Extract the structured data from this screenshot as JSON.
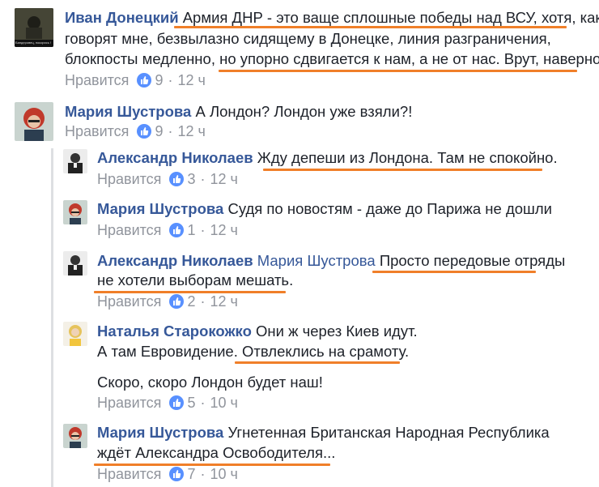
{
  "like_label": "Нравится",
  "accent": "#f07f29",
  "comments": [
    {
      "author": "Иван Донецкий",
      "lines": [
        "Армия ДНР - это ваще сплошные победы над ВСУ, хотя, как",
        "говорят мне, безвылазно сидящему в Донецке, линия разграничения,",
        "блокпосты медленно, но упорно сдвигается к нам, а не от нас. Врут, наверно."
      ],
      "likes": "9",
      "time": "12 ч",
      "avatar_text": "Бандеровец, покорись !"
    },
    {
      "author": "Мария Шустрова",
      "lines": [
        "А Лондон? Лондон уже взяли?!"
      ],
      "likes": "9",
      "time": "12 ч"
    },
    {
      "author": "Александр Николаев",
      "lines": [
        "Жду депеши из Лондона. Там не спокойно."
      ],
      "likes": "3",
      "time": "12 ч"
    },
    {
      "author": "Мария Шустрова",
      "lines": [
        "Судя по новостям - даже до Парижа не дошли"
      ],
      "likes": "1",
      "time": "12 ч"
    },
    {
      "author": "Александр Николаев",
      "mention": "Мария Шустрова",
      "lines": [
        "Просто передовые отряды",
        "не хотели выборам мешать."
      ],
      "likes": "2",
      "time": "12 ч"
    },
    {
      "author": "Наталья Старокожко",
      "lines": [
        "Они ж через Киев идут.",
        "А там Евровидение. Отвлеклись на срамоту.",
        "",
        "Скоро, скоро Лондон будет наш!"
      ],
      "likes": "5",
      "time": "10 ч"
    },
    {
      "author": "Мария Шустрова",
      "lines": [
        "Угнетенная Британская Народная Республика",
        "ждёт Александра Освободителя..."
      ],
      "likes": "7",
      "time": "10 ч"
    }
  ]
}
